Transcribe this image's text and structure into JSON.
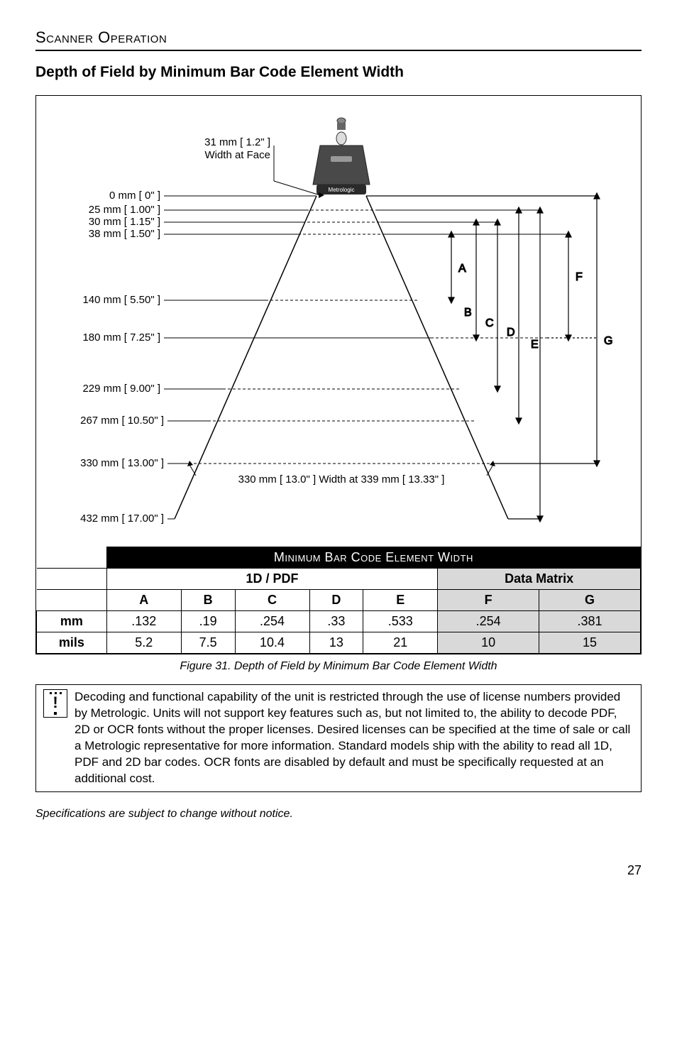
{
  "header": "Scanner Operation",
  "title": "Depth of Field by Minimum Bar Code Element Width",
  "diagram": {
    "width_face_label": "31 mm [ 1.2\" ]",
    "width_face_sub": "Width at Face",
    "scanner_label": "Metrologic",
    "left_labels": [
      "0 mm [ 0\" ]",
      "25 mm [ 1.00\" ]",
      "30 mm [ 1.15\" ]",
      "38 mm [ 1.50\" ]",
      "140 mm [ 5.50\" ]",
      "180 mm [ 7.25\" ]",
      "229 mm [ 9.00\" ]",
      "267 mm [ 10.50\" ]",
      "330 mm [ 13.00\" ]",
      "432 mm [ 17.00\" ]"
    ],
    "bottom_label": "330 mm [ 13.0\" ] Width at 339 mm [ 13.33\" ]",
    "right_labels": [
      "A",
      "B",
      "C",
      "D",
      "E",
      "F",
      "G"
    ]
  },
  "table": {
    "black_header": "Minimum Bar Code Element Width",
    "group1": "1D / PDF",
    "group2": "Data Matrix",
    "cols": [
      "A",
      "B",
      "C",
      "D",
      "E",
      "F",
      "G"
    ],
    "rows": [
      {
        "label": "mm",
        "cells": [
          ".132",
          ".19",
          ".254",
          ".33",
          ".533",
          ".254",
          ".381"
        ]
      },
      {
        "label": "mils",
        "cells": [
          "5.2",
          "7.5",
          "10.4",
          "13",
          "21",
          "10",
          "15"
        ]
      }
    ]
  },
  "figure_caption": "Figure 31.  Depth of Field by Minimum Bar Code Element Width",
  "info_text": "Decoding and functional capability of the unit is restricted through the use of license numbers provided by Metrologic. Units will not support key features such as, but not limited to, the ability to decode PDF, 2D or OCR fonts without the proper licenses. Desired licenses can be specified at the time of sale or call a Metrologic representative for more information. Standard models ship with the ability to read all 1D, PDF and 2D bar codes. OCR fonts are disabled by default and must be specifically requested at an additional cost.",
  "footnote": "Specifications are subject to change without notice.",
  "page_num": "27",
  "chart_data": {
    "type": "diagram",
    "title": "Depth of Field by Minimum Bar Code Element Width",
    "width_at_face_mm": 31,
    "width_at_face_in": 1.2,
    "width_at_339mm_mm": 330,
    "width_at_339mm_in": 13.0,
    "distance_markers_mm": [
      0,
      25,
      30,
      38,
      140,
      180,
      229,
      267,
      330,
      432
    ],
    "distance_markers_in": [
      0,
      1.0,
      1.15,
      1.5,
      5.5,
      7.25,
      9.0,
      10.5,
      13.0,
      17.0
    ],
    "ranges": {
      "A": {
        "near_mm": 38,
        "far_mm": 140
      },
      "B": {
        "near_mm": 30,
        "far_mm": 180
      },
      "C": {
        "near_mm": 30,
        "far_mm": 229
      },
      "D": {
        "near_mm": 25,
        "far_mm": 267
      },
      "E": {
        "near_mm": 25,
        "far_mm": 432
      },
      "F": {
        "near_mm": 38,
        "far_mm": 180
      },
      "G": {
        "near_mm": 0,
        "far_mm": 330
      }
    },
    "element_width": {
      "unit_groups": [
        "1D / PDF",
        "Data Matrix"
      ],
      "columns": [
        "A",
        "B",
        "C",
        "D",
        "E",
        "F",
        "G"
      ],
      "mm": [
        0.132,
        0.19,
        0.254,
        0.33,
        0.533,
        0.254,
        0.381
      ],
      "mils": [
        5.2,
        7.5,
        10.4,
        13,
        21,
        10,
        15
      ]
    }
  }
}
